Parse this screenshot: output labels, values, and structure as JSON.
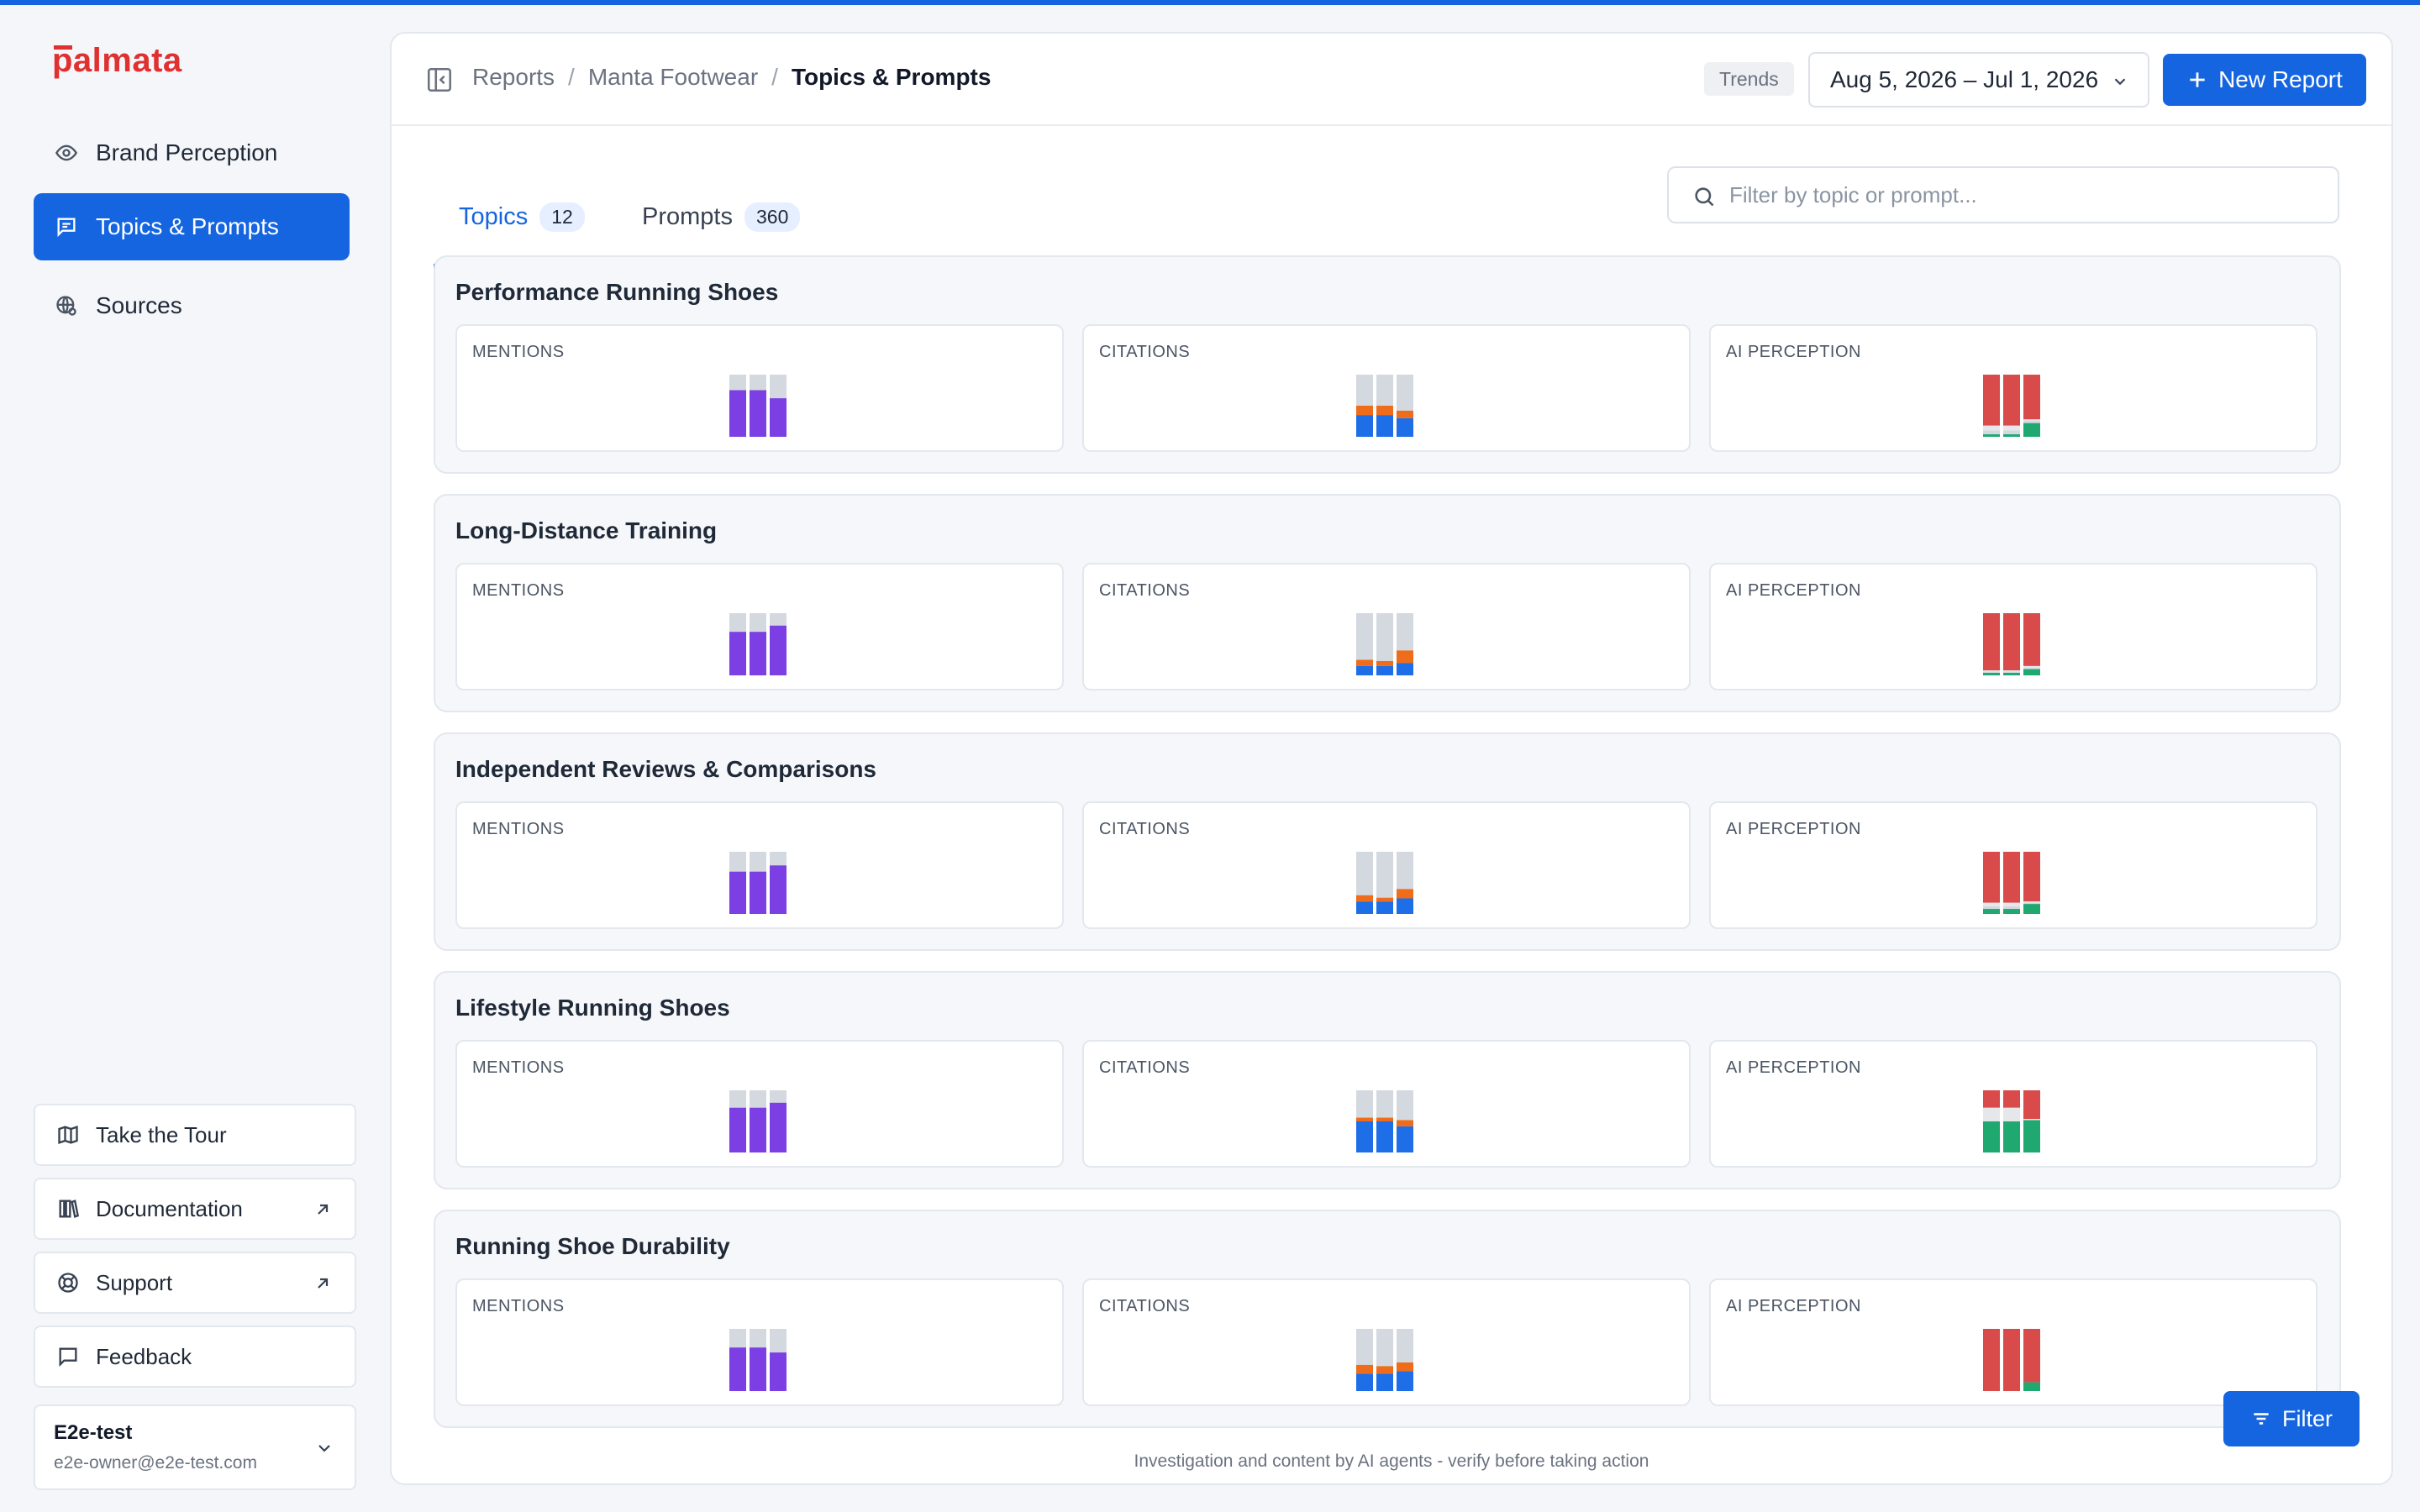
{
  "brand": {
    "logo_text": "palmata"
  },
  "sidebar": {
    "items": [
      {
        "label": "Brand Perception",
        "icon": "eye-icon"
      },
      {
        "label": "Topics & Prompts",
        "icon": "message-list-icon"
      },
      {
        "label": "Sources",
        "icon": "globe-search-icon"
      }
    ],
    "bottom": [
      {
        "label": "Take the Tour",
        "icon": "map-icon"
      },
      {
        "label": "Documentation",
        "icon": "books-icon"
      },
      {
        "label": "Support",
        "icon": "lifebuoy-icon"
      },
      {
        "label": "Feedback",
        "icon": "chat-bubble-icon"
      }
    ],
    "user": {
      "name": "E2e-test",
      "email": "e2e-owner@e2e-test.com"
    }
  },
  "header": {
    "breadcrumb": [
      "Reports",
      "Manta Footwear",
      "Topics & Prompts"
    ],
    "trends_label": "Trends",
    "date_range": "Aug 5, 2026 – Jul 1, 2026",
    "new_report_label": "New Report"
  },
  "tabs": [
    {
      "label": "Topics",
      "count": "12"
    },
    {
      "label": "Prompts",
      "count": "360"
    }
  ],
  "search": {
    "placeholder": "Filter by topic or prompt..."
  },
  "metric_labels": {
    "mentions": "MENTIONS",
    "citations": "CITATIONS",
    "perception": "AI PERCEPTION"
  },
  "colors": {
    "mentions": "#7b3fe4",
    "citations_primary": "#1e6ee8",
    "citations_secondary": "#ef6c1a",
    "negative": "#d94a4a",
    "neutral": "#d1d6dd",
    "positive": "#1fa870",
    "track": "#d4d9e0"
  },
  "topics": [
    {
      "name": "Performance Running Shoes",
      "mentions": [
        0.75,
        0.75,
        0.62
      ],
      "citations": [
        [
          0.35,
          0.15
        ],
        [
          0.35,
          0.15
        ],
        [
          0.3,
          0.12
        ]
      ],
      "perception": [
        [
          0.82,
          0.08,
          0.04
        ],
        [
          0.82,
          0.08,
          0.04
        ],
        [
          0.72,
          0.02,
          0.22
        ]
      ]
    },
    {
      "name": "Long-Distance Training",
      "mentions": [
        0.7,
        0.7,
        0.8
      ],
      "citations": [
        [
          0.15,
          0.1
        ],
        [
          0.15,
          0.08
        ],
        [
          0.2,
          0.2
        ]
      ],
      "perception": [
        [
          0.92,
          0.02,
          0.04
        ],
        [
          0.92,
          0.02,
          0.04
        ],
        [
          0.85,
          0.03,
          0.1
        ]
      ]
    },
    {
      "name": "Independent Reviews & Comparisons",
      "mentions": [
        0.68,
        0.68,
        0.78
      ],
      "citations": [
        [
          0.2,
          0.1
        ],
        [
          0.2,
          0.06
        ],
        [
          0.25,
          0.15
        ]
      ],
      "perception": [
        [
          0.82,
          0.06,
          0.08
        ],
        [
          0.82,
          0.06,
          0.08
        ],
        [
          0.8,
          0.02,
          0.16
        ]
      ]
    },
    {
      "name": "Lifestyle Running Shoes",
      "mentions": [
        0.72,
        0.72,
        0.8
      ],
      "citations": [
        [
          0.5,
          0.06
        ],
        [
          0.5,
          0.06
        ],
        [
          0.42,
          0.1
        ]
      ],
      "perception": [
        [
          0.28,
          0.22,
          0.5
        ],
        [
          0.28,
          0.22,
          0.5
        ],
        [
          0.46,
          0.02,
          0.52
        ]
      ]
    },
    {
      "name": "Running Shoe Durability",
      "mentions": [
        0.7,
        0.7,
        0.62
      ],
      "citations": [
        [
          0.28,
          0.14
        ],
        [
          0.28,
          0.12
        ],
        [
          0.32,
          0.14
        ]
      ],
      "perception": [
        [
          1.0,
          0.0,
          0.0
        ],
        [
          1.0,
          0.0,
          0.0
        ],
        [
          0.86,
          0.0,
          0.14
        ]
      ]
    }
  ],
  "footer_note": "Investigation and content by AI agents - verify before taking action",
  "filter_label": "Filter"
}
